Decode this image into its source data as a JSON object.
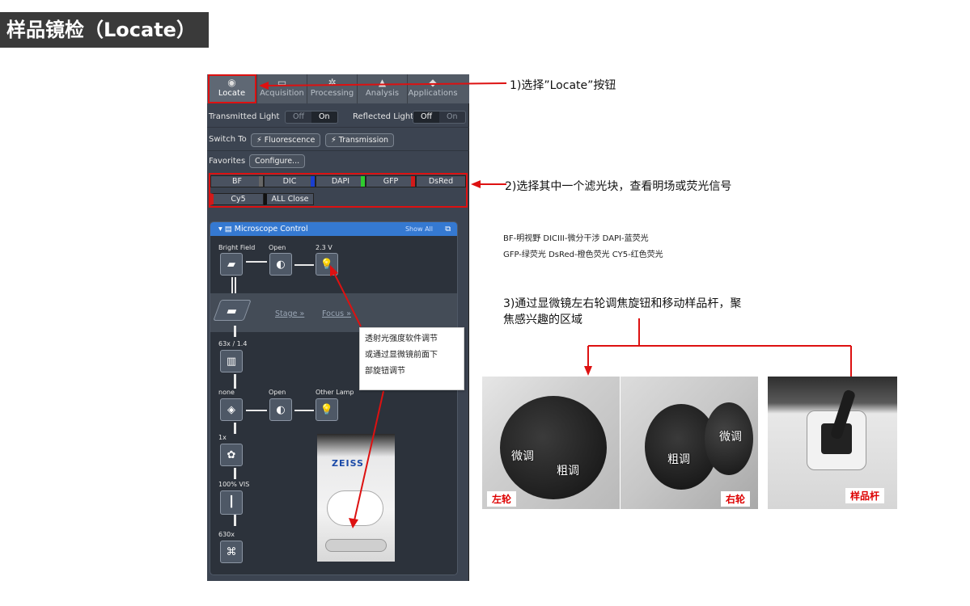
{
  "page_title": "样品镜检（Locate）",
  "software": {
    "tabs": [
      {
        "label": "Locate",
        "icon": "eye-icon"
      },
      {
        "label": "Acquisition",
        "icon": "camera-icon"
      },
      {
        "label": "Processing",
        "icon": "gear-icon"
      },
      {
        "label": "Analysis",
        "icon": "chart-icon"
      },
      {
        "label": "Applications",
        "icon": "app-icon"
      }
    ],
    "transmitted_light": {
      "label": "Transmitted Light",
      "off": "Off",
      "on": "On",
      "selected": "On"
    },
    "reflected_light": {
      "label": "Reflected Light",
      "off": "Off",
      "on": "On",
      "selected": "Off"
    },
    "switch_to": {
      "label": "Switch To",
      "fluorescence": "Fluorescence",
      "transmission": "Transmission"
    },
    "favorites": {
      "label": "Favorites",
      "configure": "Configure..."
    },
    "filters": [
      {
        "label": "BF",
        "color": "#555555"
      },
      {
        "label": "DIC",
        "color": "#1a3fd0"
      },
      {
        "label": "DAPI",
        "color": "#2fcc2f"
      },
      {
        "label": "GFP",
        "color": "#d21a1a"
      },
      {
        "label": "DsRed",
        "color": "#d21a1a"
      },
      {
        "label": "Cy5",
        "color": "#d21a1a"
      },
      {
        "label": "ALL Close",
        "color": "#222222"
      }
    ],
    "microscope_control": {
      "title": "Microscope Control",
      "show_all": "Show All",
      "bright_field": "Bright Field",
      "open1": "Open",
      "voltage": "2.3 V",
      "stage": "Stage »",
      "focus": "Focus »",
      "objective": "63x / 1.4",
      "none": "none",
      "open2": "Open",
      "other_lamp": "Other Lamp",
      "mag1": "1x",
      "vis": "100% VIS",
      "mag2": "630x"
    }
  },
  "annotations": {
    "step1": "1)选择”Locate”按钮",
    "step2": "2)选择其中一个滤光块，查看明场或荧光信号",
    "legend_line1": "BF-明视野  DICIII-微分干涉 DAPI-蓝荧光",
    "legend_line2": "GFP-绿荧光 DsRed-橙色荧光  CY5-红色荧光",
    "step3_line1": "3)通过显微镜左右轮调焦旋钮和移动样品杆，聚",
    "step3_line2": "焦感兴趣的区域",
    "callout_line1": "透射光强度软件调节",
    "callout_line2": "或通过显微镜前面下",
    "callout_line3": "部旋钮调节",
    "zeiss": "ZEISS"
  },
  "photos": {
    "left": {
      "label": "左轮",
      "fine": "微调",
      "coarse": "粗调"
    },
    "right": {
      "label": "右轮",
      "fine": "微调",
      "coarse": "粗调"
    },
    "stage": {
      "label": "样品杆"
    }
  }
}
